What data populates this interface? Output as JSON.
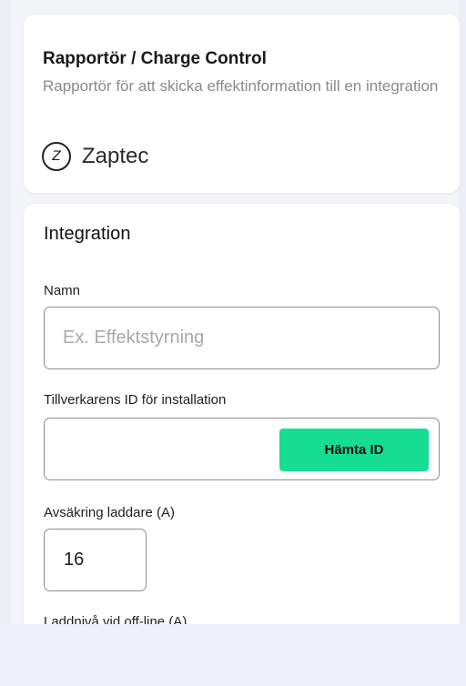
{
  "provider_card": {
    "title": "Rapportör / Charge Control",
    "description": "Rapportör för att skicka effektinformation till en integration",
    "brand": {
      "logo_letter": "Z",
      "name": "Zaptec"
    }
  },
  "integration_card": {
    "title": "Integration",
    "name_field": {
      "label": "Namn",
      "placeholder": "Ex. Effektstyrning",
      "value": ""
    },
    "manufacturer_id_field": {
      "label": "Tillverkarens ID för installation",
      "value": "",
      "fetch_button_label": "Hämta ID"
    },
    "fuse_field": {
      "label": "Avsäkring laddare (A)",
      "value": "16"
    },
    "offline_level_field": {
      "label": "Laddnivå vid off-line (A)"
    }
  },
  "colors": {
    "accent_button": "#17dd93",
    "page_background": "#eef1fb",
    "card_background": "#ffffff",
    "muted_text": "#8a8a8a"
  }
}
